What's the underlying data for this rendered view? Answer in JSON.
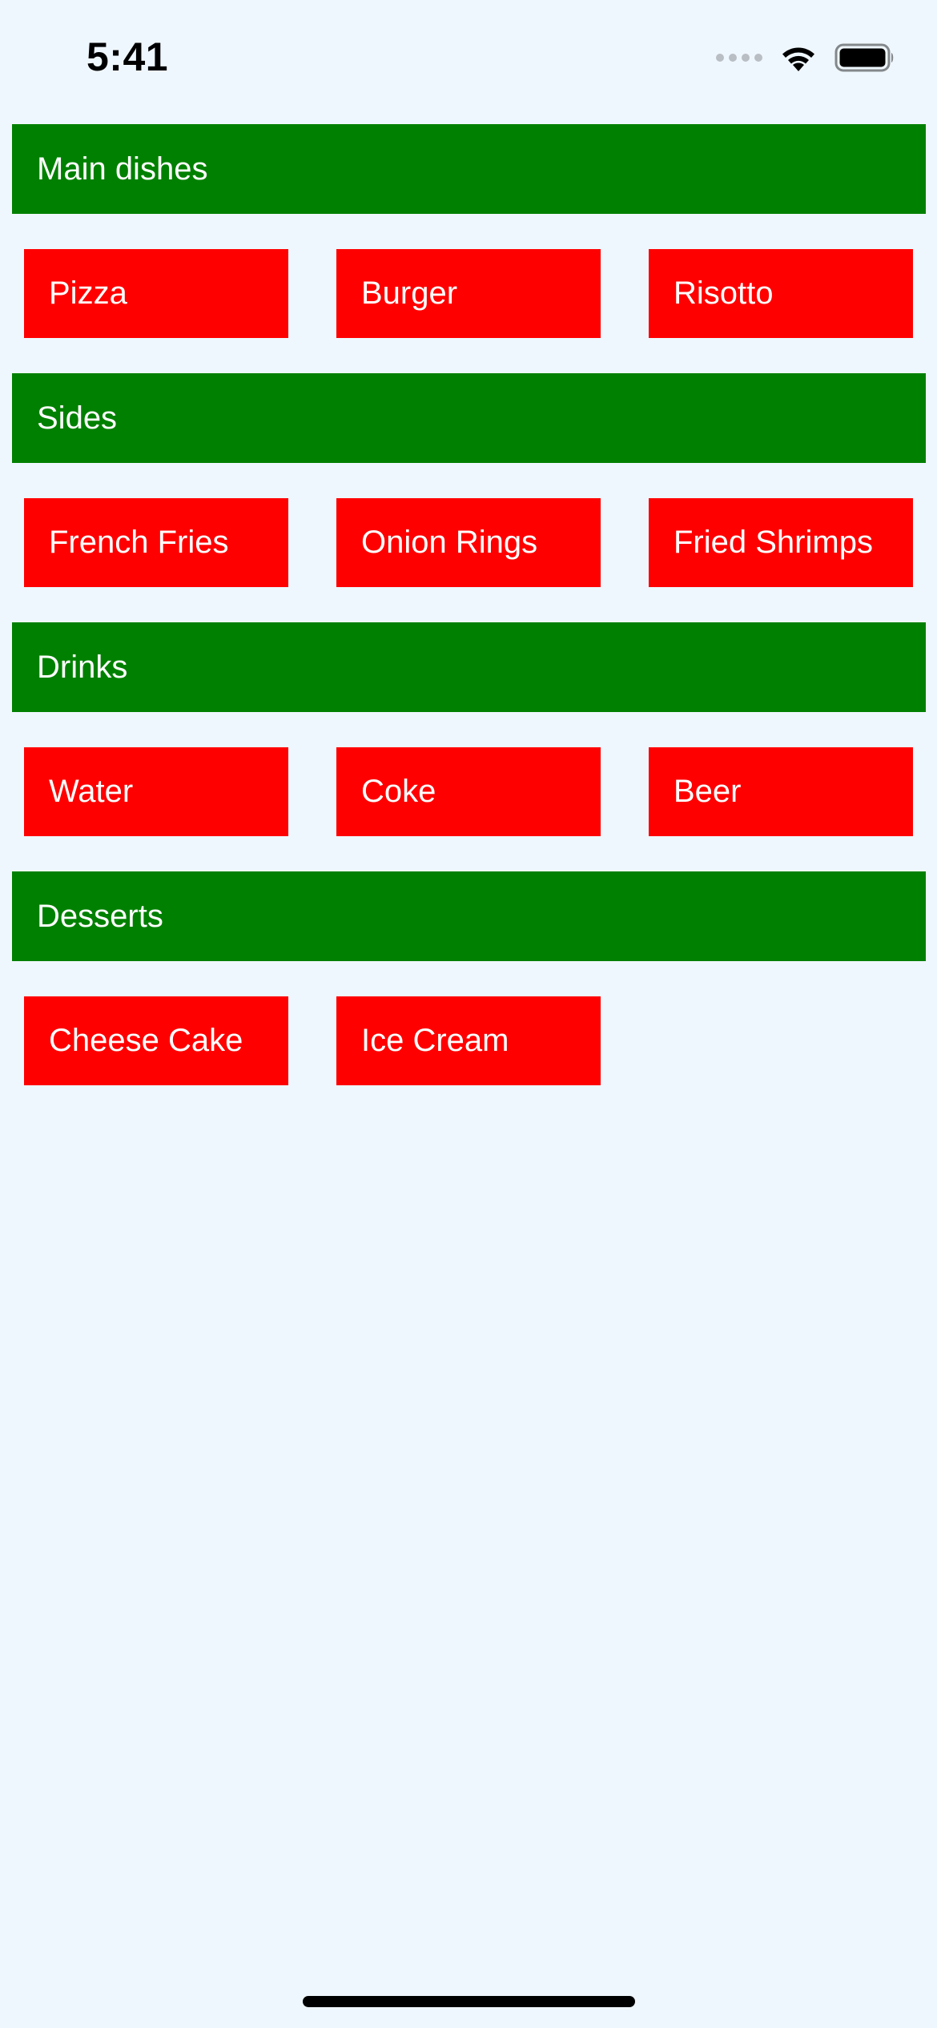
{
  "status_bar": {
    "time": "5:41",
    "icons": [
      "cellular-signal-icon",
      "wifi-icon",
      "battery-icon"
    ]
  },
  "colors": {
    "background": "#EFF7FE",
    "section_header": "#008000",
    "item": "#FF0000",
    "text": "#FFFFFF"
  },
  "sections": [
    {
      "title": "Main dishes",
      "items": [
        "Pizza",
        "Burger",
        "Risotto"
      ]
    },
    {
      "title": "Sides",
      "items": [
        "French Fries",
        "Onion Rings",
        "Fried Shrimps"
      ]
    },
    {
      "title": "Drinks",
      "items": [
        "Water",
        "Coke",
        "Beer"
      ]
    },
    {
      "title": "Desserts",
      "items": [
        "Cheese Cake",
        "Ice Cream"
      ]
    }
  ]
}
